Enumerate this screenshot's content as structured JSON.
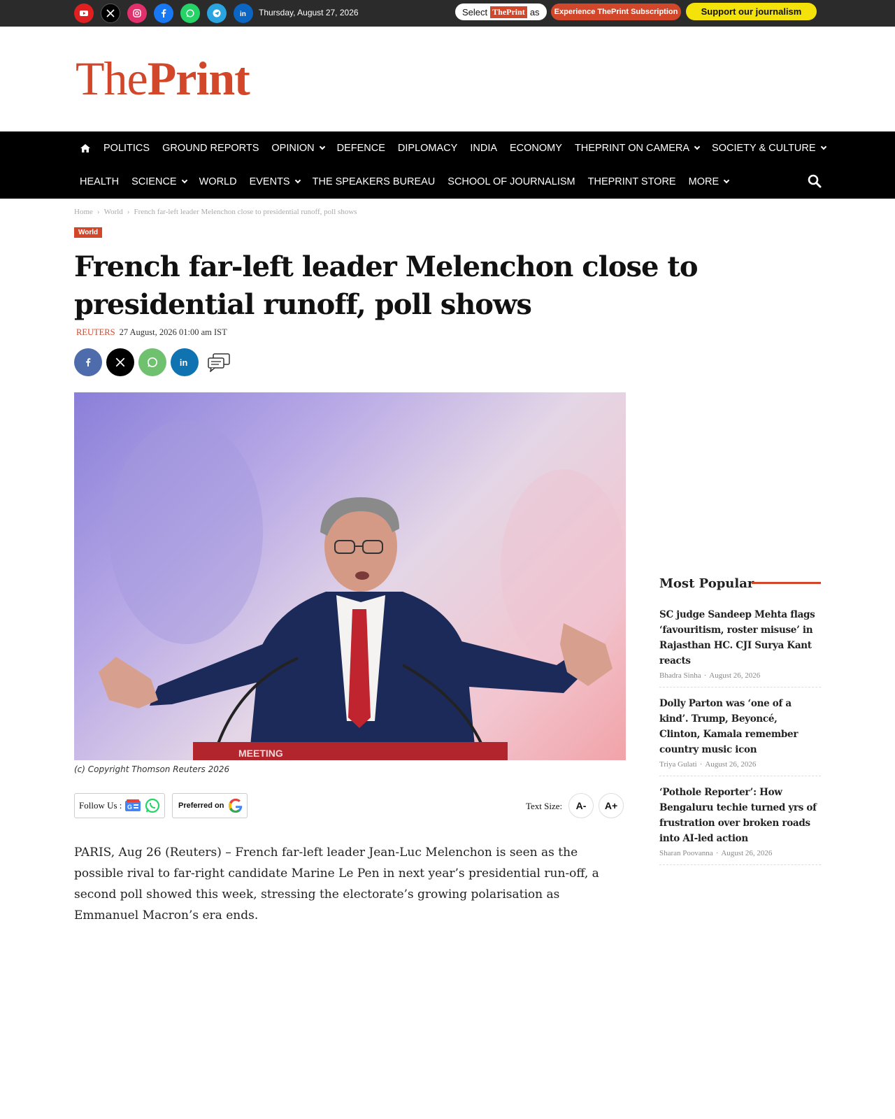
{
  "topbar": {
    "date": "Thursday, August 27, 2026",
    "social": [
      {
        "name": "youtube-icon",
        "color": "#e02020"
      },
      {
        "name": "x-icon",
        "color": "#000000"
      },
      {
        "name": "instagram-icon",
        "color": "#e1306c"
      },
      {
        "name": "facebook-icon",
        "color": "#1877f2"
      },
      {
        "name": "whatsapp-icon",
        "color": "#25d366"
      },
      {
        "name": "telegram-icon",
        "color": "#2aa4e0"
      },
      {
        "name": "linkedin-icon",
        "color": "#0a66c2"
      }
    ],
    "select_prefix": "Select",
    "select_brand": "ThePrint",
    "select_suffix": "as",
    "subscription_label": "Experience ThePrint Subscription",
    "support_label": "Support our journalism"
  },
  "logo": {
    "part1": "The",
    "part2": "Print",
    "color": "#d2472a"
  },
  "nav": {
    "row1": [
      {
        "label": "POLITICS",
        "dropdown": false
      },
      {
        "label": "GROUND REPORTS",
        "dropdown": false
      },
      {
        "label": "OPINION",
        "dropdown": true
      },
      {
        "label": "DEFENCE",
        "dropdown": false
      },
      {
        "label": "DIPLOMACY",
        "dropdown": false
      },
      {
        "label": "INDIA",
        "dropdown": false
      },
      {
        "label": "ECONOMY",
        "dropdown": false
      },
      {
        "label": "THEPRINT ON CAMERA",
        "dropdown": true
      },
      {
        "label": "SOCIETY & CULTURE",
        "dropdown": true
      }
    ],
    "row2": [
      {
        "label": "HEALTH",
        "dropdown": false
      },
      {
        "label": "SCIENCE",
        "dropdown": true
      },
      {
        "label": "WORLD",
        "dropdown": false
      },
      {
        "label": "EVENTS",
        "dropdown": true
      },
      {
        "label": "THE SPEAKERS BUREAU",
        "dropdown": false
      },
      {
        "label": "SCHOOL OF JOURNALISM",
        "dropdown": false
      },
      {
        "label": "THEPRINT STORE",
        "dropdown": false
      },
      {
        "label": "MORE",
        "dropdown": true
      }
    ]
  },
  "breadcrumb": {
    "home": "Home",
    "section": "World",
    "current": "French far-left leader Melenchon close to presidential runoff, poll shows",
    "sep": "›"
  },
  "article": {
    "category": "World",
    "title": "French far-left leader Melenchon close to presidential runoff, poll shows",
    "author": "REUTERS",
    "date": "27 August, 2026 01:00 am IST",
    "image_caption": "(c) Copyright Thomson Reuters 2026",
    "image_text": "MEETING",
    "body": "PARIS, Aug 26 (Reuters) – French far-left leader Jean-Luc Melenchon is seen as the possible rival to far-right candidate Marine Le Pen in next year’s presidential run-off, a second poll showed this week, stressing the electorate’s growing polarisation as Emmanuel Macron’s era ends."
  },
  "share": [
    {
      "name": "facebook-share-button",
      "color": "#4e6bac",
      "glyph": "f"
    },
    {
      "name": "x-share-button",
      "color": "#000000",
      "glyph": "X"
    },
    {
      "name": "whatsapp-share-button",
      "color": "#6fc16f",
      "glyph": "w"
    },
    {
      "name": "linkedin-share-button",
      "color": "#0f73b1",
      "glyph": "in"
    }
  ],
  "tools": {
    "follow_label": "Follow Us :",
    "preferred_label": "Preferred on",
    "text_size_label": "Text Size:",
    "decrease_label": "A-",
    "increase_label": "A+"
  },
  "sidebar": {
    "title": "Most Popular",
    "items": [
      {
        "headline": "SC judge Sandeep Mehta flags ‘favouritism, roster misuse’ in Rajasthan HC. CJI Surya Kant reacts",
        "author": "Bhadra Sinha",
        "date": "August 26, 2026"
      },
      {
        "headline": "Dolly Parton was ‘one of a kind’. Trump, Beyoncé, Clinton, Kamala remember country music icon",
        "author": "Triya Gulati",
        "date": "August 26, 2026"
      },
      {
        "headline": "‘Pothole Reporter’: How Bengaluru techie turned yrs of frustration over broken roads into AI-led action",
        "author": "Sharan Poovanna",
        "date": "August 26, 2026"
      }
    ]
  }
}
